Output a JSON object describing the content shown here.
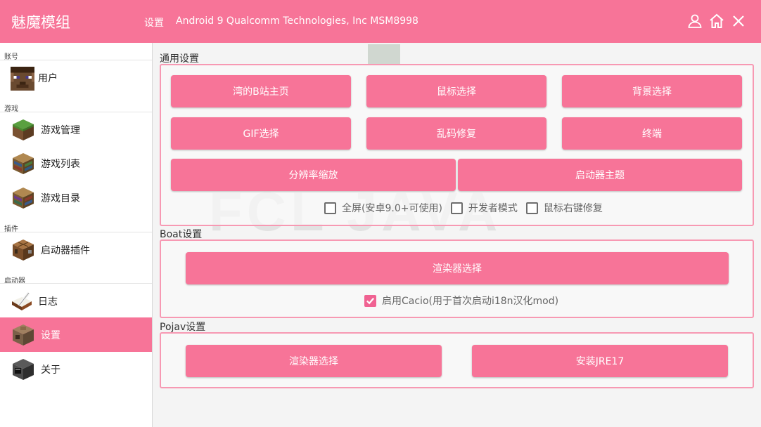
{
  "header": {
    "title": "魅魔模组",
    "active_tab": "设置",
    "device": "Android 9  Qualcomm Technologies, Inc MSM8998",
    "icons": [
      "user-icon",
      "home-icon",
      "close-icon"
    ]
  },
  "sidebar": {
    "sections": {
      "account": "账号",
      "game": "游戏",
      "plugin": "插件",
      "launcher": "启动器"
    },
    "items": {
      "user": "用户",
      "game_manage": "游戏管理",
      "game_list": "游戏列表",
      "game_dir": "游戏目录",
      "launcher_plugin": "启动器插件",
      "log": "日志",
      "settings": "设置",
      "about": "关于"
    }
  },
  "general": {
    "title": "通用设置",
    "buttons": {
      "bili": "湾的B站主页",
      "mouse": "鼠标选择",
      "background": "背景选择",
      "gif": "GIF选择",
      "fix": "乱码修复",
      "terminal": "终端",
      "resolution": "分辨率缩放",
      "theme": "启动器主题"
    },
    "checks": {
      "fullscreen": "全屏(安卓9.0+可使用)",
      "developer": "开发者模式",
      "right_click": "鼠标右键修复"
    }
  },
  "boat": {
    "title": "Boat设置",
    "renderer": "渲染器选择",
    "cacio": "启用Cacio(用于首次启动i18n汉化mod)"
  },
  "pojav": {
    "title": "Pojav设置",
    "renderer": "渲染器选择",
    "jre": "安装JRE17"
  },
  "colors": {
    "accent": "#f77498",
    "panel_border": "#f799b3",
    "checkbox_checked": "#f06292"
  }
}
